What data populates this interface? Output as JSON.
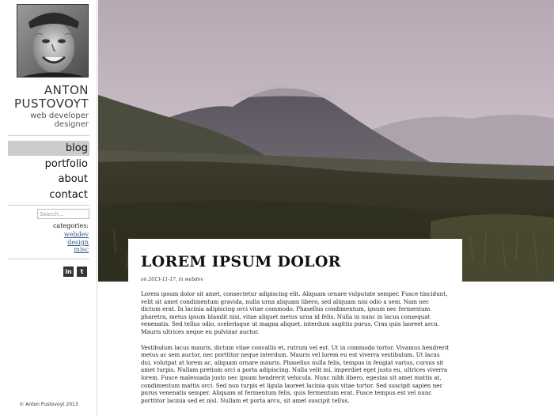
{
  "profile": {
    "first_name": "ANTON",
    "last_name": "PUSTOVOYT",
    "role_1": "web developer",
    "role_2": "designer"
  },
  "nav": {
    "items": [
      {
        "label": "blog",
        "active": true
      },
      {
        "label": "portfolio",
        "active": false
      },
      {
        "label": "about",
        "active": false
      },
      {
        "label": "contact",
        "active": false
      }
    ]
  },
  "search": {
    "placeholder": "Search..."
  },
  "categories": {
    "title": "categories:",
    "items": [
      "webdev",
      "design",
      "misc"
    ]
  },
  "social": {
    "linkedin": "in",
    "tumblr": "t"
  },
  "footer": {
    "copyright": "© Anton Pustovoyt 2013"
  },
  "post": {
    "title": "LOREM IPSUM DOLOR",
    "meta_prefix": "on",
    "date": "2013-11-17",
    "meta_in": ", in",
    "category": "webdev",
    "paragraph_1": "Lorem ipsum dolor sit amet, consectetur adipiscing elit. Aliquam ornare vulputate semper. Fusce tincidunt, velit sit amet condimentum gravida, nulla urna aliquam libero, sed aliquam nisi odio a sem. Nam nec dictum erat. In lacinia adipiscing orci vitae commodo. Phasellus condimentum, ipsum nec fermentum pharetra, metus ipsum blandit nisi, vitae aliquet metus urna id felis. Nulla in nunc in lacus consequat venenatis. Sed tellus odio, scelerisque ut magna aliquet, interdum sagittis purus. Cras quis laoreet arcu. Mauris ultrices neque eu pulvinar auctor.",
    "paragraph_2": "Vestibulum lacus mauris, dictum vitae convallis et, rutrum vel est. Ut in commodo tortor. Vivamus hendrerit metus ac sem auctor, nec porttitor neque interdum. Mauris vel lorem eu est viverra vestibulum. Ut lacus dui, volutpat at lorem ac, aliquam ornare mauris. Phasellus nulla felis, tempus in feugiat varius, cursus sit amet turpis. Nullam pretium orci a porta adipiscing. Nulla velit mi, imperdiet eget justo eu, ultrices viverra lorem. Fusce malesuada justo nec ipsum hendrerit vehicula. Nunc nibh libero, egestas sit amet mattis at, condimentum mattis orci. Sed non turpis et ligula laoreet lacinia quis vitae tortor. Sed suscipit sapien nec purus venenatis semper. Aliquam at fermentum felis, quis fermentum erat. Fusce tempus est vel nunc porttitor lacinia sed et nisl. Nullam et porta arcu, sit amet suscipit tellus."
  },
  "colors": {
    "nav_active_bg": "#cccccc",
    "link": "#3a5a8a",
    "social_bg": "#333333"
  }
}
